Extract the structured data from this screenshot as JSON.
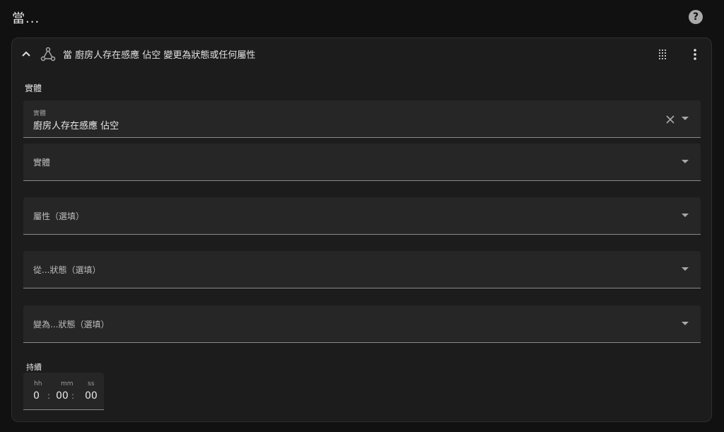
{
  "header": {
    "title": "當...",
    "help_icon": "help-circle-icon",
    "help_glyph": "?"
  },
  "trigger": {
    "title": "當 廚房人存在感應 佔空 變更為狀態或任何屬性",
    "icons": [
      "chevron-up-icon",
      "state-trigger-icon",
      "drag-handle-icon",
      "more-vertical-icon"
    ]
  },
  "section": {
    "label": "實體"
  },
  "fields": {
    "entity": {
      "label": "實體",
      "value": "廚房人存在感應 佔空"
    },
    "entity_add": {
      "placeholder": "實體"
    },
    "attribute": {
      "placeholder": "屬性（選填）"
    },
    "from_state": {
      "placeholder": "從...狀態（選填）"
    },
    "to_state": {
      "placeholder": "變為...狀態（選填）"
    }
  },
  "duration": {
    "label": "持續",
    "hours_label": "hh",
    "minutes_label": "mm",
    "seconds_label": "ss",
    "hours": "0",
    "minutes": "00",
    "seconds": "00",
    "separator": ":"
  },
  "colors": {
    "background": "#111111",
    "card": "#1c1c1c",
    "field": "#262626",
    "text": "#e1e1e1"
  }
}
